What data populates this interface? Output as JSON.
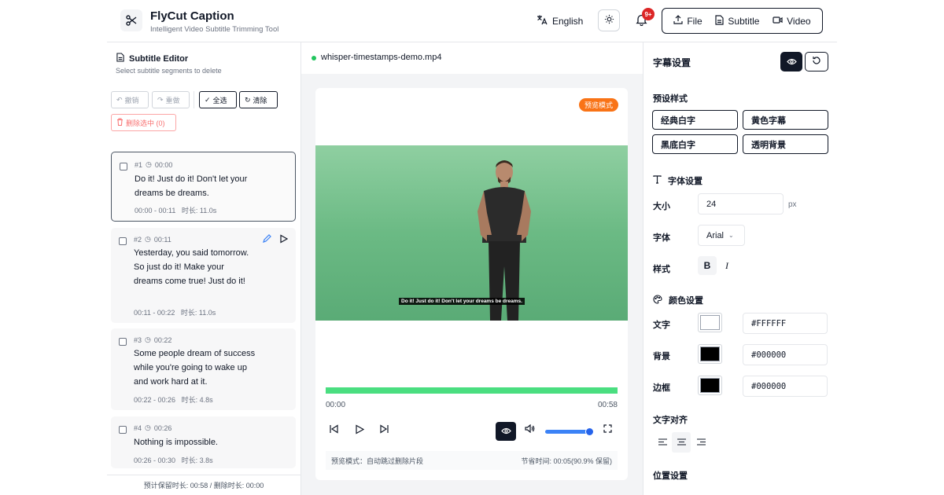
{
  "header": {
    "app_title": "FlyCut Caption",
    "app_subtitle": "Intelligent Video Subtitle Trimming Tool",
    "language": "English",
    "notification_badge": "9+",
    "menu": {
      "file": "File",
      "subtitle": "Subtitle",
      "video": "Video"
    }
  },
  "editor": {
    "title": "Subtitle Editor",
    "subtitle": "Select subtitle segments to delete",
    "toolbar": {
      "undo": "撤销",
      "redo": "重做",
      "select_all": "全选",
      "clear": "清除",
      "delete_selected": "删除选中 (0)"
    },
    "segments": [
      {
        "id": "#1",
        "start": "00:00",
        "text": "Do it! Just do it! Don't let your dreams be dreams.",
        "range": "00:00 - 00:11",
        "duration": "时长: 11.0s"
      },
      {
        "id": "#2",
        "start": "00:11",
        "text": "Yesterday, you said tomorrow. So just do it! Make your dreams come true! Just do it!",
        "range": "00:11 - 00:22",
        "duration": "时长: 11.0s"
      },
      {
        "id": "#3",
        "start": "00:22",
        "text": "Some people dream of success while you're going to wake up and work hard at it.",
        "range": "00:22 - 00:26",
        "duration": "时长: 4.8s"
      },
      {
        "id": "#4",
        "start": "00:26",
        "text": "Nothing is impossible.",
        "range": "00:26 - 00:30",
        "duration": "时长: 3.8s"
      }
    ],
    "footer": "预计保留时长: 00:58 / 删除时长: 00:00"
  },
  "player": {
    "file_name": "whisper-timestamps-demo.mp4",
    "preview_badge": "预览模式",
    "caption": "Do it! Just do it! Don't let your dreams be dreams.",
    "time_current": "00:00",
    "time_total": "00:58",
    "progress": 1.0,
    "volume": 0.9,
    "footer_left": "预览模式：自动跳过删除片段",
    "footer_right": "节省时间: 00:05(90.9% 保留)"
  },
  "settings": {
    "title": "字幕设置",
    "presets_label": "预设样式",
    "presets": [
      "经典白字",
      "黄色字幕",
      "黑底白字",
      "透明背景"
    ],
    "font_section": "字体设置",
    "size_label": "大小",
    "size_value": "24",
    "size_unit": "px",
    "family_label": "字体",
    "family_value": "Arial",
    "style_label": "样式",
    "bold": "B",
    "italic": "I",
    "color_section": "颜色设置",
    "text_label": "文字",
    "text_color": "#FFFFFF",
    "bg_label": "背景",
    "bg_color": "#000000",
    "border_label": "边框",
    "border_color": "#000000",
    "align_label": "文字对齐",
    "position_label": "位置设置"
  },
  "colors": {
    "accent_green": "#4ade80",
    "badge_orange": "#f97316",
    "badge_red": "#dc2626",
    "slider_blue": "#3b82f6"
  }
}
